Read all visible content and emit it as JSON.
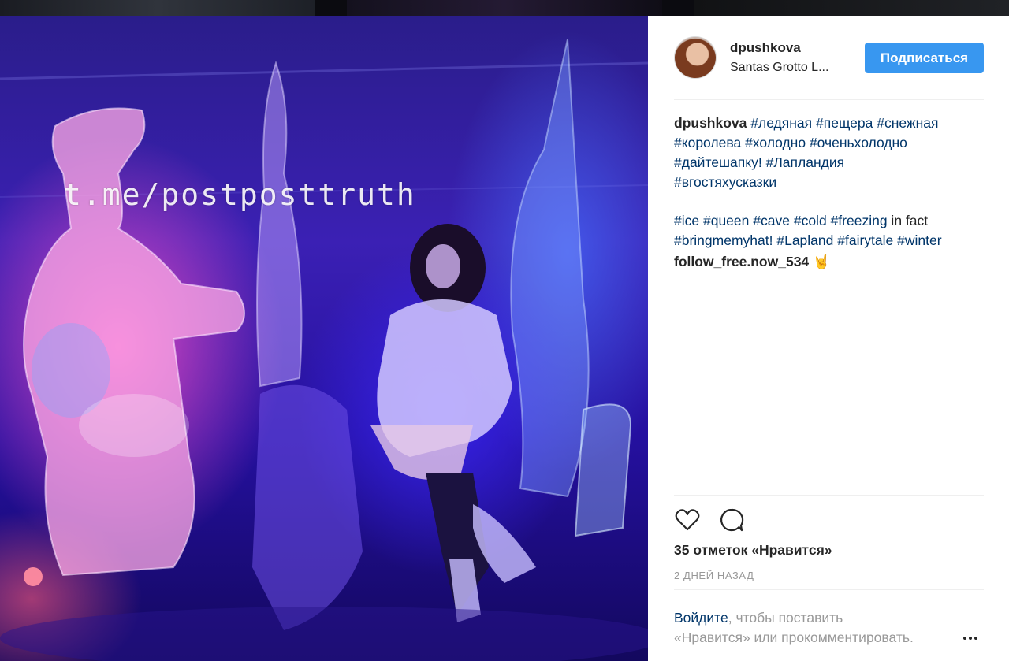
{
  "post": {
    "username": "dpushkova",
    "location": "Santas Grotto L...",
    "follow_label": "Подписаться",
    "watermark": "t.me/postposttruth"
  },
  "caption": {
    "author": "dpushkova",
    "line1_tags": [
      "#ледяная",
      "#пещера",
      "#снежная"
    ],
    "line2_tags": [
      "#королева",
      "#холодно",
      "#оченьхолодно"
    ],
    "line3_tags": [
      "#дайтешапку!",
      "#Лапландия"
    ],
    "line4_tags": [
      "#вгостяхусказки"
    ],
    "line5_tags": [
      "#ice",
      "#queen",
      "#cave",
      "#cold",
      "#freezing"
    ],
    "line5_text": " in fact",
    "line6_tags": [
      "#bringmemyhat!",
      "#Lapland",
      "#fairytale",
      "#winter"
    ]
  },
  "comment": {
    "username": "follow_free.now_534",
    "emoji": "🤘"
  },
  "likes": "35 отметок «Нравится»",
  "time": "2 ДНЕЙ НАЗАД",
  "login_prompt": {
    "link": "Войдите",
    "text_a": ", чтобы поставить",
    "text_b": "«Нравится» или прокомментировать."
  },
  "icons": [
    "heart-icon",
    "comment-icon",
    "more-options-icon"
  ],
  "colors": {
    "follow_button": "#3897f0",
    "hashtag": "#003569",
    "muted": "#999999"
  }
}
